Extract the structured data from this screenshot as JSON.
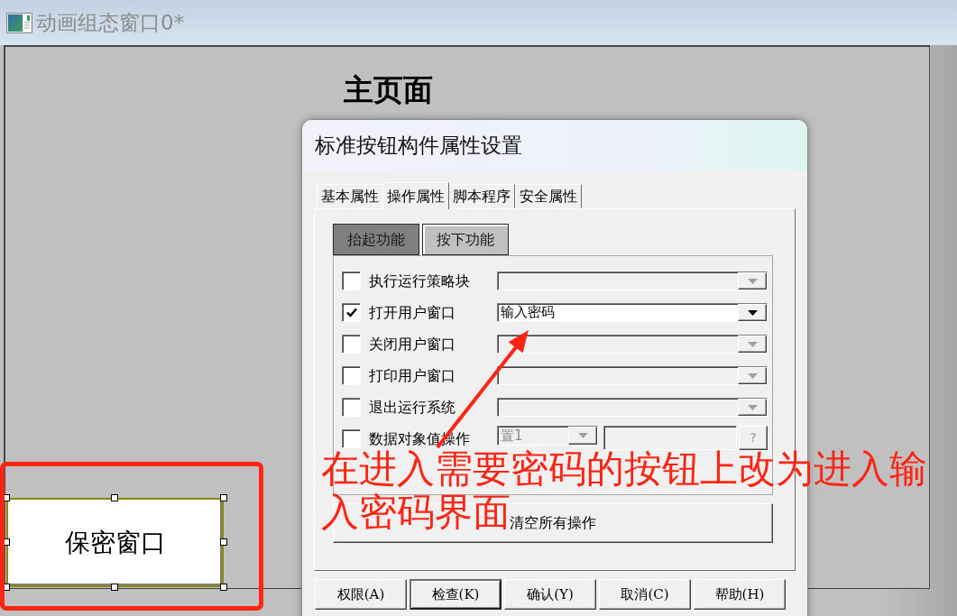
{
  "window": {
    "title": "动画组态窗口0*"
  },
  "canvas": {
    "heading": "主页面",
    "widget": {
      "label": "保密窗口",
      "selected": true
    }
  },
  "dialog": {
    "title": "标准按钮构件属性设置",
    "tabs": [
      {
        "label": "基本属性",
        "selected": false
      },
      {
        "label": "操作属性",
        "selected": true
      },
      {
        "label": "脚本程序",
        "selected": false
      },
      {
        "label": "安全属性",
        "selected": false
      }
    ],
    "sub_tabs": [
      {
        "label": "抬起功能",
        "selected": true
      },
      {
        "label": "按下功能",
        "selected": false
      }
    ],
    "actions": [
      {
        "kind": "dropdown",
        "label": "执行运行策略块",
        "checked": false
      },
      {
        "kind": "dropdown",
        "label": "打开用户窗口",
        "checked": true,
        "value": "输入密码"
      },
      {
        "kind": "dropdown",
        "label": "关闭用户窗口",
        "checked": false
      },
      {
        "kind": "dropdown",
        "label": "打印用户窗口",
        "checked": false
      },
      {
        "kind": "dropdown",
        "label": "退出运行系统",
        "checked": false
      },
      {
        "kind": "value_operation",
        "label": "数据对象值操作",
        "checked": false,
        "operation": "置1",
        "help": "?"
      }
    ],
    "clear_button": "清空所有操作",
    "buttons": [
      {
        "label": "权限(A)",
        "default": false
      },
      {
        "label": "检查(K)",
        "default": true
      },
      {
        "label": "确认(Y)",
        "default": false
      },
      {
        "label": "取消(C)",
        "default": false
      },
      {
        "label": "帮助(H)",
        "default": false
      }
    ]
  },
  "annotation": {
    "lines": [
      "在进入需要密码的按钮上改为进入输",
      "入密码界面"
    ]
  }
}
